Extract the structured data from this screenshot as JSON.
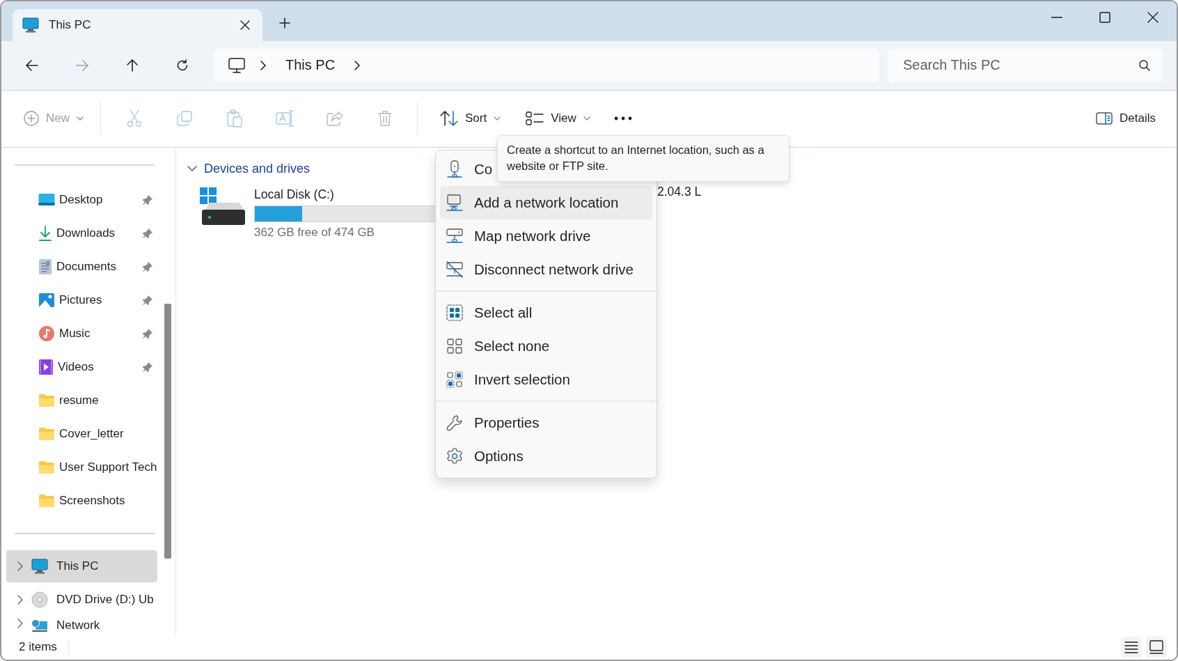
{
  "tabs": [
    {
      "label": "This PC",
      "selected": true
    }
  ],
  "address": {
    "crumbs": [
      "This PC"
    ]
  },
  "search": {
    "placeholder": "Search This PC"
  },
  "toolbar": {
    "items": [
      {
        "kind": "new",
        "label": "New",
        "disabled": true
      },
      {
        "kind": "cut",
        "disabled": true
      },
      {
        "kind": "copy",
        "disabled": true
      },
      {
        "kind": "paste",
        "disabled": true
      },
      {
        "kind": "rename",
        "disabled": true
      },
      {
        "kind": "share",
        "disabled": true
      },
      {
        "kind": "delete",
        "disabled": true
      },
      {
        "kind": "sort",
        "label": "Sort",
        "disabled": false
      },
      {
        "kind": "view",
        "label": "View",
        "disabled": false
      },
      {
        "kind": "more",
        "disabled": false
      }
    ],
    "details": {
      "label": "Details"
    }
  },
  "sidebar": {
    "quick_access": [
      {
        "label": "Desktop",
        "kind": "desktop",
        "pinned": true
      },
      {
        "label": "Downloads",
        "kind": "downloads",
        "pinned": true
      },
      {
        "label": "Documents",
        "kind": "documents",
        "pinned": true
      },
      {
        "label": "Pictures",
        "kind": "pictures",
        "pinned": true
      },
      {
        "label": "Music",
        "kind": "music",
        "pinned": true
      },
      {
        "label": "Videos",
        "kind": "videos",
        "pinned": true
      },
      {
        "label": "resume",
        "kind": "folder",
        "pinned": false
      },
      {
        "label": "Cover_letter",
        "kind": "folder",
        "pinned": false
      },
      {
        "label": "User Support Tech",
        "kind": "folder",
        "pinned": false
      },
      {
        "label": "Screenshots",
        "kind": "folder",
        "pinned": false
      }
    ],
    "tree": [
      {
        "label": "This PC",
        "kind": "pc",
        "selected": true
      },
      {
        "label": "DVD Drive (D:) Ub",
        "kind": "dvd",
        "selected": false
      },
      {
        "label": "Network",
        "kind": "network",
        "selected": false
      }
    ]
  },
  "content": {
    "groups": [
      {
        "title": "Devices and drives",
        "expanded": true,
        "drives": [
          {
            "name": "Local Disk (C:)",
            "level": 0.236,
            "free": "362 GB free of 474 GB"
          },
          {
            "name": "2.04.3 L"
          }
        ]
      }
    ]
  },
  "menu": {
    "groups": [
      [
        {
          "kind": "connect",
          "label": "Co",
          "selected": false
        },
        {
          "kind": "add-location",
          "label": "Add a network location",
          "selected": true
        },
        {
          "kind": "map-drive",
          "label": "Map network drive",
          "selected": false
        },
        {
          "kind": "disconnect",
          "label": "Disconnect network drive",
          "selected": false
        }
      ],
      [
        {
          "kind": "select-all",
          "label": "Select all",
          "selected": false
        },
        {
          "kind": "select-none",
          "label": "Select none",
          "selected": false
        },
        {
          "kind": "invert",
          "label": "Invert selection",
          "selected": false
        }
      ],
      [
        {
          "kind": "properties",
          "label": "Properties",
          "selected": false
        },
        {
          "kind": "options",
          "label": "Options",
          "selected": false
        }
      ]
    ]
  },
  "tooltip": {
    "text": "Create a shortcut to an Internet location, such as a website or FTP site."
  },
  "status_bar": {
    "count": "2 items"
  }
}
